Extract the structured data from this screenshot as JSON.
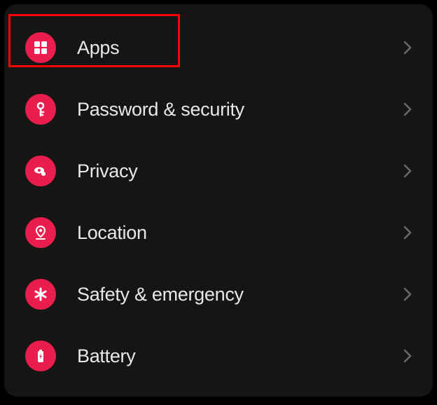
{
  "settings": {
    "items": [
      {
        "label": "Apps",
        "icon": "apps",
        "highlighted": true
      },
      {
        "label": "Password & security",
        "icon": "key",
        "highlighted": false
      },
      {
        "label": "Privacy",
        "icon": "privacy",
        "highlighted": false
      },
      {
        "label": "Location",
        "icon": "location",
        "highlighted": false
      },
      {
        "label": "Safety & emergency",
        "icon": "asterisk",
        "highlighted": false
      },
      {
        "label": "Battery",
        "icon": "battery",
        "highlighted": false
      }
    ]
  },
  "colors": {
    "accent": "#e91e4d",
    "highlight": "#ff0000",
    "background": "#151515",
    "text": "#e8e8e8"
  }
}
